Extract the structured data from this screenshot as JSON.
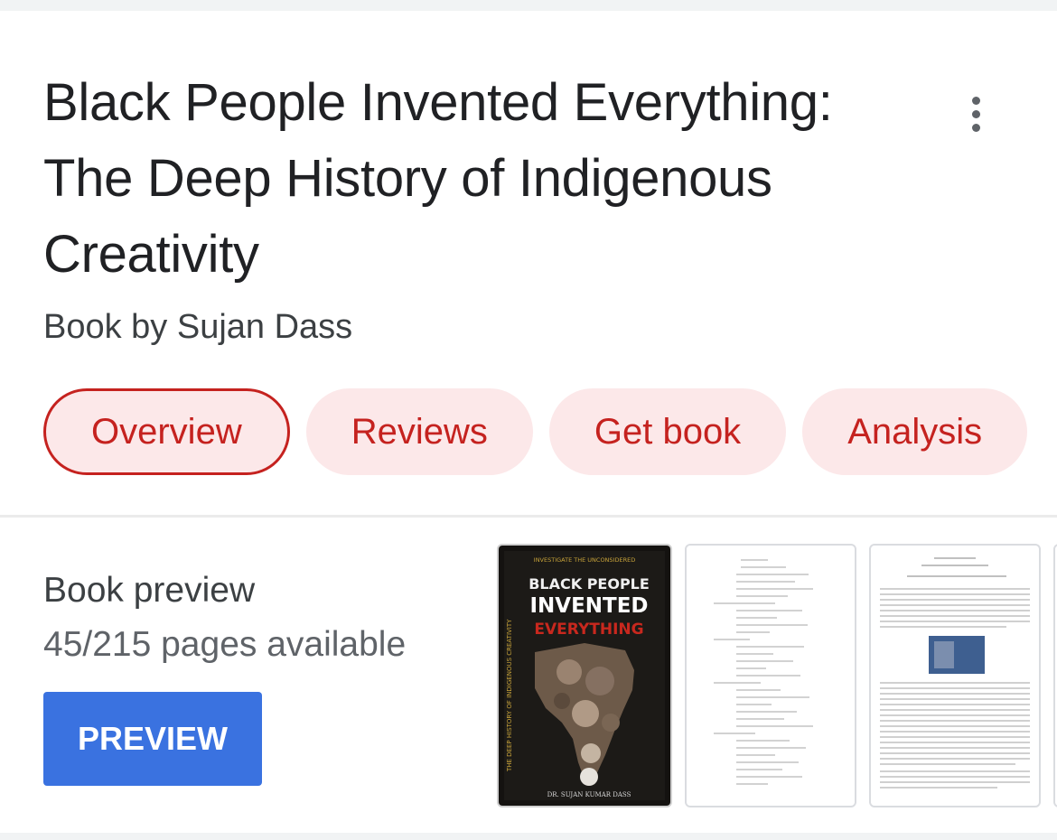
{
  "book": {
    "title": "Black People Invented Everything: The Deep History of Indigenous Creativity",
    "subtitle": "Book by Sujan Dass"
  },
  "menu": {
    "icon": "more-vert-icon"
  },
  "tabs": [
    {
      "label": "Overview",
      "active": true
    },
    {
      "label": "Reviews",
      "active": false
    },
    {
      "label": "Get book",
      "active": false
    },
    {
      "label": "Analysis",
      "active": false
    }
  ],
  "preview": {
    "heading": "Book preview",
    "pages": "45/215 pages available",
    "button_label": "PREVIEW"
  },
  "cover": {
    "top_text": "INVESTIGATE THE UNCONSIDERED",
    "line1": "BLACK PEOPLE",
    "line2": "INVENTED",
    "line3": "EVERYTHING",
    "spine_text": "THE DEEP HISTORY OF INDIGENOUS CREATIVITY",
    "author": "DR. SUJAN KUMAR DASS"
  },
  "colors": {
    "chip_bg": "#fce8e9",
    "chip_text": "#c5221f",
    "button_bg": "#3a72e0"
  }
}
